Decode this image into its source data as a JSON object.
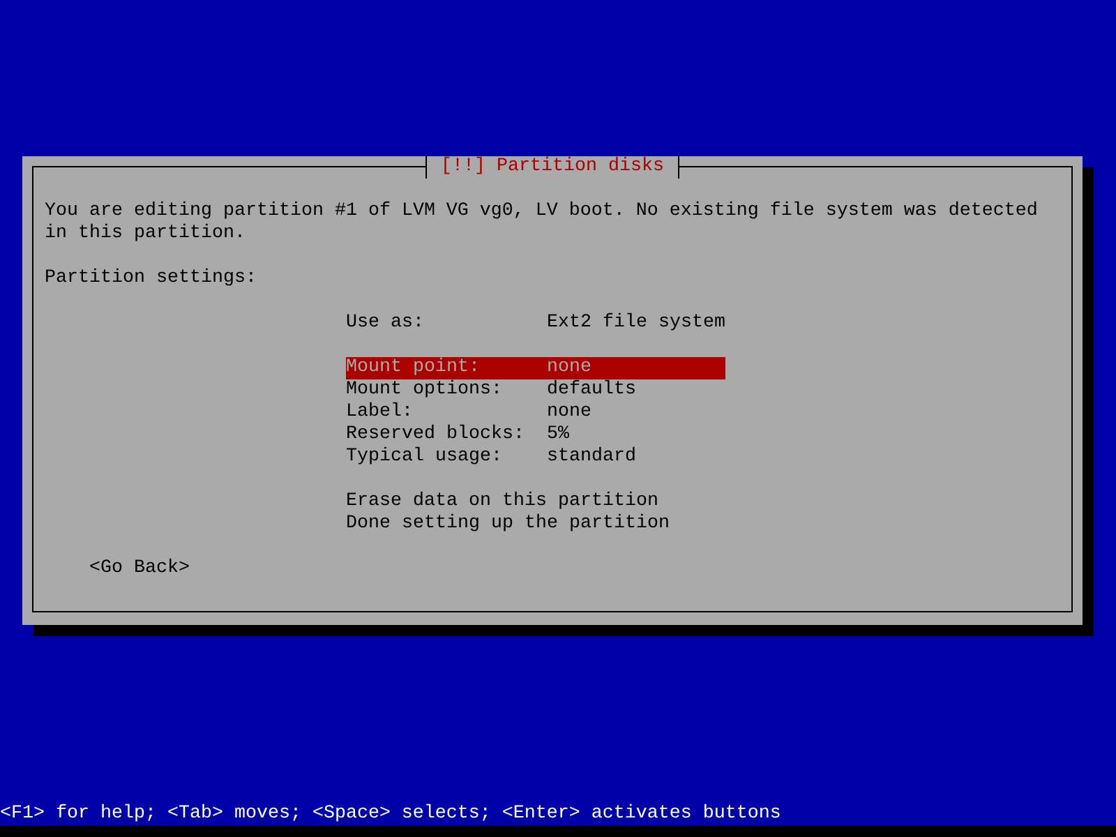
{
  "dialog": {
    "title": "[!!] Partition disks",
    "message": "You are editing partition #1 of LVM VG vg0, LV boot. No existing file system was detected in this partition.",
    "section_label": "Partition settings:",
    "menu_groups": [
      {
        "items": [
          {
            "label": "Use as:",
            "value": "Ext2 file system",
            "selected": false
          }
        ]
      },
      {
        "items": [
          {
            "label": "Mount point:",
            "value": "none",
            "selected": true
          },
          {
            "label": "Mount options:",
            "value": "defaults",
            "selected": false
          },
          {
            "label": "Label:",
            "value": "none",
            "selected": false
          },
          {
            "label": "Reserved blocks:",
            "value": "5%",
            "selected": false
          },
          {
            "label": "Typical usage:",
            "value": "standard",
            "selected": false
          }
        ]
      },
      {
        "items": [
          {
            "label": "Erase data on this partition",
            "selected": false
          },
          {
            "label": "Done setting up the partition",
            "selected": false
          }
        ]
      }
    ],
    "back_button": "<Go Back>"
  },
  "status_bar": "<F1> for help; <Tab> moves; <Space> selects; <Enter> activates buttons"
}
